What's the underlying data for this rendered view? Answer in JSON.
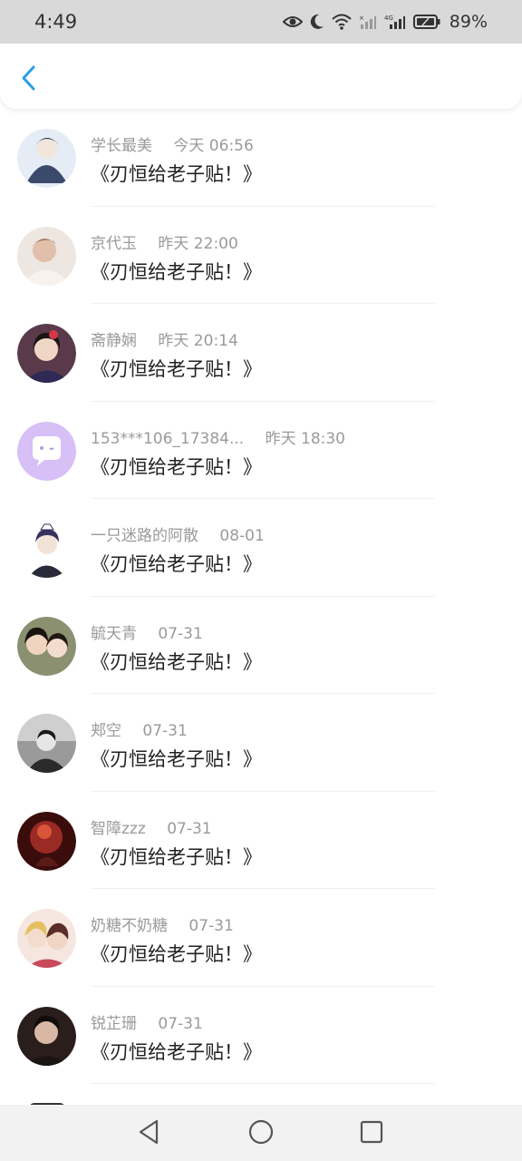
{
  "status_bar": {
    "time": "4:49",
    "network_label": "4G",
    "battery": "89%"
  },
  "header": {
    "back_icon": "chevron-left-icon",
    "accent": "#2a9ee8"
  },
  "messages": [
    {
      "name": "学长最美",
      "time": "今天 06:56",
      "text": "《刃恒给老子贴！》",
      "avatar_color": "#3b4a6b"
    },
    {
      "name": "京代玉",
      "time": "昨天 22:00",
      "text": "《刃恒给老子贴！》",
      "avatar_color": "#d9b7a4"
    },
    {
      "name": "斋静娴",
      "time": "昨天 20:14",
      "text": "《刃恒给老子贴！》",
      "avatar_color": "#3a2f4d"
    },
    {
      "name": "153***106_17384...",
      "time": "昨天 18:30",
      "text": "《刃恒给老子贴！》",
      "avatar_color": "#d6c0f5"
    },
    {
      "name": "一只迷路的阿散",
      "time": "08-01",
      "text": "《刃恒给老子贴！》",
      "avatar_color": "#4a3d5c"
    },
    {
      "name": "毓天青",
      "time": "07-31",
      "text": "《刃恒给老子贴！》",
      "avatar_color": "#6b7552"
    },
    {
      "name": "郏空",
      "time": "07-31",
      "text": "《刃恒给老子贴！》",
      "avatar_color": "#555555"
    },
    {
      "name": "智障zzz",
      "time": "07-31",
      "text": "《刃恒给老子贴！》",
      "avatar_color": "#7a1f1c"
    },
    {
      "name": "奶糖不奶糖",
      "time": "07-31",
      "text": "《刃恒给老子贴！》",
      "avatar_color": "#c98a6a"
    },
    {
      "name": "锐芷珊",
      "time": "07-31",
      "text": "《刃恒给老子贴！》",
      "avatar_color": "#3e2b2a"
    }
  ],
  "nav": {
    "back": "triangle-back-icon",
    "home": "circle-home-icon",
    "recents": "square-recents-icon"
  }
}
